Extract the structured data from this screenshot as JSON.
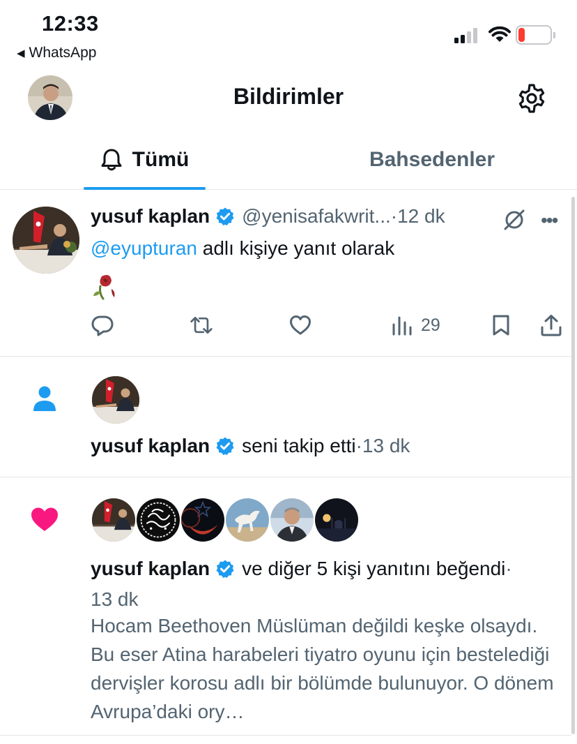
{
  "status_bar": {
    "time": "12:33",
    "back_app": "WhatsApp",
    "battery": "20",
    "battery_color": "#ff3b30"
  },
  "header": {
    "title": "Bildirimler",
    "avatar_icon": "profile-avatar",
    "settings_icon": "gear-icon"
  },
  "tabs": [
    {
      "label": "Tümü",
      "icon": "bell-icon",
      "active": true
    },
    {
      "label": "Bahsedenler",
      "active": false
    }
  ],
  "colors": {
    "accent": "#1d9bf0",
    "text": "#0f1419",
    "muted": "#536471",
    "like": "#f91880",
    "follow": "#1d9bf0"
  },
  "notifications": [
    {
      "type": "reply",
      "name": "yusuf kaplan",
      "handle": "@yenisafakwrit...",
      "sep": " · ",
      "time": "12 dk",
      "reply_mention": "@eyupturan",
      "reply_text": " adlı kişiye yanıt olarak",
      "emoji": "wilted-rose",
      "actions": {
        "reply": "reply-icon",
        "retweet": "retweet-icon",
        "like": "heart-icon",
        "views": "29",
        "bookmark": "bookmark-icon",
        "share": "share-icon"
      }
    },
    {
      "type": "follow",
      "name": "yusuf kaplan",
      "text": "seni takip etti",
      "sep": " · ",
      "time": "13 dk"
    },
    {
      "type": "like",
      "name": "yusuf kaplan",
      "text": "ve diğer 5 kişi yanıtını beğendi",
      "sep": " ·",
      "time": "13 dk",
      "tweet_text": "Hocam Beethoven Müslüman değildi keşke olsaydı. Bu eser Atina harabeleri tiyatro oyunu için bestelediği dervişler korosu adlı bir bölümde bulunuyor. O dönem Avrupa’daki ory…"
    }
  ]
}
